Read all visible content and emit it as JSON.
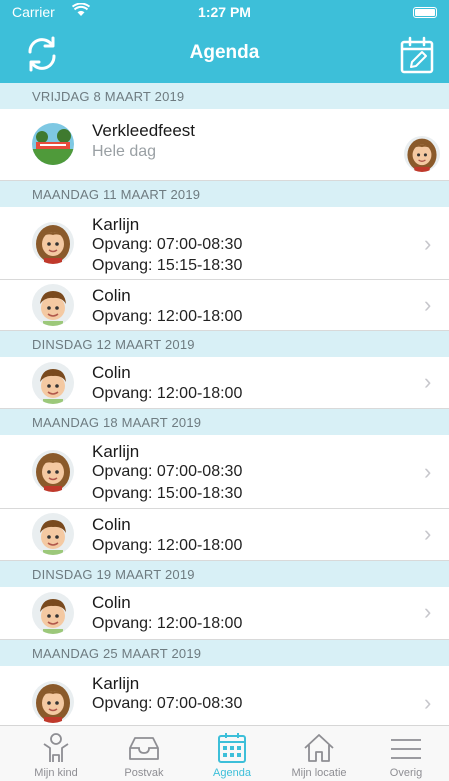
{
  "status": {
    "carrier": "Carrier",
    "time": "1:27 PM"
  },
  "header": {
    "title": "Agenda"
  },
  "sections": [
    {
      "date": "VRIJDAG 8 MAART 2019"
    },
    {
      "date": "MAANDAG 11 MAART 2019"
    },
    {
      "date": "DINSDAG 12 MAART 2019"
    },
    {
      "date": "MAANDAG 18 MAART 2019"
    },
    {
      "date": "DINSDAG 19 MAART 2019"
    },
    {
      "date": "MAANDAG 25 MAART 2019"
    }
  ],
  "event": {
    "title": "Verkleedfeest",
    "subtitle": "Hele dag"
  },
  "rows": [
    {
      "name": "Karlijn",
      "lines": [
        "Opvang: 07:00-08:30",
        "Opvang: 15:15-18:30"
      ]
    },
    {
      "name": "Colin",
      "lines": [
        "Opvang: 12:00-18:00"
      ]
    },
    {
      "name": "Colin",
      "lines": [
        "Opvang: 12:00-18:00"
      ]
    },
    {
      "name": "Karlijn",
      "lines": [
        "Opvang: 07:00-08:30",
        "Opvang: 15:00-18:30"
      ]
    },
    {
      "name": "Colin",
      "lines": [
        "Opvang: 12:00-18:00"
      ]
    },
    {
      "name": "Colin",
      "lines": [
        "Opvang: 12:00-18:00"
      ]
    },
    {
      "name": "Karlijn",
      "lines": [
        "Opvang: 07:00-08:30"
      ]
    }
  ],
  "tabs": [
    {
      "label": "Mijn kind",
      "icon": "child-icon"
    },
    {
      "label": "Postvak",
      "icon": "inbox-icon"
    },
    {
      "label": "Agenda",
      "icon": "calendar-icon",
      "active": true
    },
    {
      "label": "Mijn locatie",
      "icon": "home-icon"
    },
    {
      "label": "Overig",
      "icon": "menu-icon"
    }
  ],
  "colors": {
    "accent": "#3dbfd9",
    "section_bg": "#d8f0f6",
    "inactive": "#8e8e93"
  }
}
